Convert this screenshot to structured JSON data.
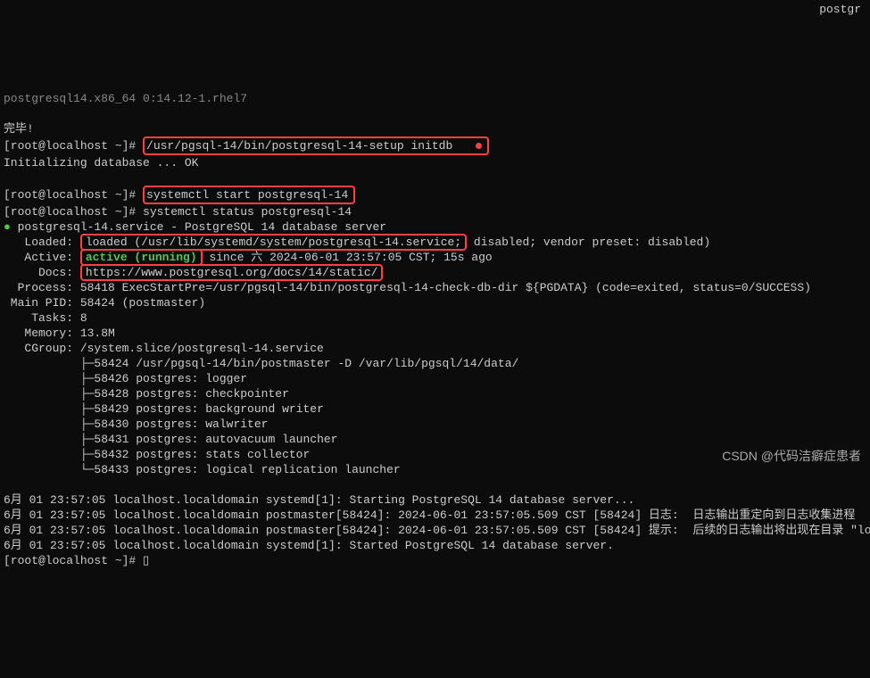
{
  "top_truncated": "postgresql14.x86_64 0:14.12-1.rhel7",
  "top_right": "postgr",
  "done": "完毕!",
  "prompt": "[root@localhost ~]# ",
  "cmd_initdb": "/usr/pgsql-14/bin/postgresql-14-setup initdb",
  "init_result": "Initializing database ... OK",
  "cmd_start": "systemctl start postgresql-14",
  "cmd_status": "systemctl status postgresql-14",
  "svc_header": " postgresql-14.service - PostgreSQL 14 database server",
  "svc_loaded_pre": "   Loaded: ",
  "svc_loaded_boxed": "loaded (/usr/lib/systemd/system/postgresql-14.service;",
  "svc_loaded_post": " disabled; vendor preset: disabled)",
  "svc_active_pre": "   Active: ",
  "svc_active_state": "active (running)",
  "svc_active_post": " since 六 2024-06-01 23:57:05 CST; 15s ago",
  "svc_docs_pre": "     Docs: ",
  "svc_docs": "https://www.postgresql.org/docs/14/static/",
  "svc_process": "  Process: 58418 ExecStartPre=/usr/pgsql-14/bin/postgresql-14-check-db-dir ${PGDATA} (code=exited, status=0/SUCCESS)",
  "svc_mainpid": " Main PID: 58424 (postmaster)",
  "svc_tasks": "    Tasks: 8",
  "svc_memory": "   Memory: 13.8M",
  "svc_cgroup": "   CGroup: /system.slice/postgresql-14.service",
  "tree": [
    "├─58424 /usr/pgsql-14/bin/postmaster -D /var/lib/pgsql/14/data/",
    "├─58426 postgres: logger",
    "├─58428 postgres: checkpointer",
    "├─58429 postgres: background writer",
    "├─58430 postgres: walwriter",
    "├─58431 postgres: autovacuum launcher",
    "├─58432 postgres: stats collector",
    "└─58433 postgres: logical replication launcher"
  ],
  "logs": [
    "6月 01 23:57:05 localhost.localdomain systemd[1]: Starting PostgreSQL 14 database server...",
    "6月 01 23:57:05 localhost.localdomain postmaster[58424]: 2024-06-01 23:57:05.509 CST [58424] 日志:  日志输出重定向到日志收集进程",
    "6月 01 23:57:05 localhost.localdomain postmaster[58424]: 2024-06-01 23:57:05.509 CST [58424] 提示:  后续的日志输出将出现在目录 \"log\"中.",
    "6月 01 23:57:05 localhost.localdomain systemd[1]: Started PostgreSQL 14 database server."
  ],
  "cursor": "▯",
  "watermark": "CSDN @代码洁癖症患者"
}
